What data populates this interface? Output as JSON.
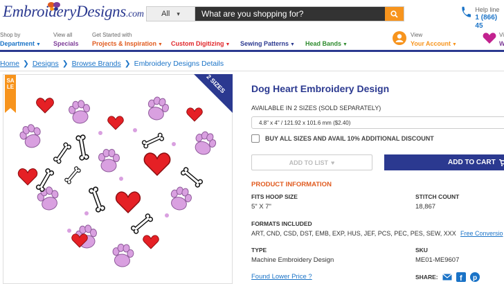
{
  "header": {
    "logo_text": "Embroidery",
    "logo_suffix": "Designs",
    "logo_com": ".com",
    "search_category": "All",
    "search_placeholder": "What are you shopping for?",
    "help_label": "Help line",
    "help_number": "1 (866) 45"
  },
  "nav": {
    "department": {
      "top": "Shop by",
      "label": "Department"
    },
    "specials": {
      "top": "View all",
      "label": "Specials"
    },
    "projects": {
      "top": "Get Started with",
      "label": "Projects & Inspiration"
    },
    "digitizing": {
      "label": "Custom Digitizing"
    },
    "sewing": {
      "label": "Sewing Patterns"
    },
    "headbands": {
      "label": "Head Bands"
    },
    "account": {
      "top": "View",
      "label": "Your Account"
    },
    "wishlist": {
      "top": "Vi",
      "label": "W"
    }
  },
  "breadcrumb": [
    "Home",
    "Designs",
    "Browse Brands",
    "Embroidery Designs Details"
  ],
  "product": {
    "sale_badge": "SALE",
    "sizes_badge": "2 SIZES",
    "title": "Dog Heart Embroidery Design",
    "availability": "AVAILABLE IN 2 SIZES (SOLD SEPARATELY)",
    "selected_size": "4.8\" x 4\" / 121.92 x 101.6 mm ($2.40)",
    "bundle_label": "BUY ALL SIZES AND AVAIL 10% ADDITIONAL DISCOUNT",
    "add_to_list": "ADD TO LIST",
    "add_to_cart": "ADD TO CART",
    "info_title": "PRODUCT INFORMATION",
    "fits_hoop_label": "FITS HOOP SIZE",
    "fits_hoop_value": "5\" X 7\"",
    "stitch_label": "STITCH COUNT",
    "stitch_value": "18,867",
    "formats_label": "FORMATS INCLUDED",
    "formats_value": "ART, CND, CSD, DST, EMB, EXP, HUS, JEF, PCS, PEC, PES, SEW, XXX",
    "free_conversion": "Free Conversio",
    "type_label": "TYPE",
    "type_value": "Machine Embroidery Design",
    "sku_label": "SKU",
    "sku_value": "ME01-ME9607",
    "lower_price": "Found Lower Price ?",
    "share_label": "SHARE:"
  },
  "colors": {
    "brand_navy": "#2b3990",
    "accent_orange": "#f7941d",
    "link_blue": "#1a73c7",
    "paw_pink": "#d9a0e0",
    "heart_red": "#e52025"
  }
}
